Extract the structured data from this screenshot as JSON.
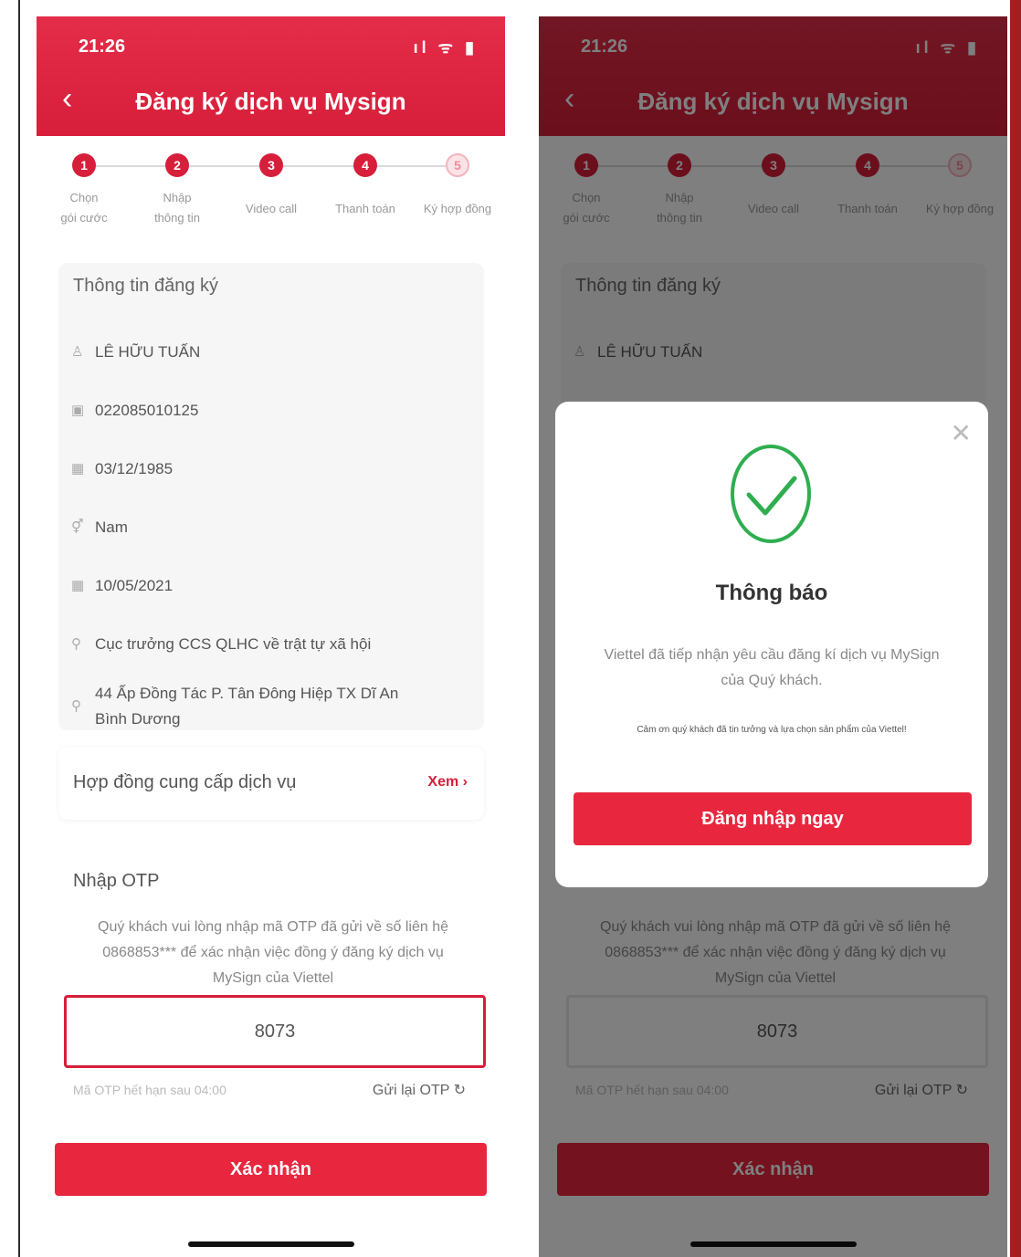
{
  "colors": {
    "brand_red": "#d71e3a",
    "button_red": "#e8273f",
    "success_green": "#2fae4f"
  },
  "status_bar": {
    "time": "21:26",
    "icons": "ıl ᯤ ▮"
  },
  "header": {
    "back_icon": "chevron-left-icon",
    "title": "Đăng ký dịch vụ Mysign"
  },
  "steps": [
    {
      "number": "1",
      "label_line1": "Chọn",
      "label_line2": "gói cước",
      "done": true
    },
    {
      "number": "2",
      "label_line1": "Nhập",
      "label_line2": "thông tin",
      "done": true
    },
    {
      "number": "3",
      "label_line1": "Video call",
      "label_line2": "",
      "done": true
    },
    {
      "number": "4",
      "label_line1": "Thanh toán",
      "label_line2": "",
      "done": true
    },
    {
      "number": "5",
      "label_line1": "Ký hợp đồng",
      "label_line2": "",
      "done": false
    }
  ],
  "registration_info": {
    "title": "Thông tin đăng ký",
    "name": "LÊ HỮU TUẤN",
    "id_number": "022085010125",
    "birth_date": "03/12/1985",
    "gender": "Nam",
    "issue_date": "10/05/2021",
    "issued_by": "Cục trưởng CCS QLHC về trật tự xã hội",
    "address_line1": "44 Ấp Đồng Tác P. Tân Đông Hiệp TX Dĩ An",
    "address_line2": "Bình Dương"
  },
  "contract": {
    "label": "Hợp đồng cung cấp dịch vụ",
    "link": "Xem"
  },
  "otp": {
    "title": "Nhập OTP",
    "description_line1": "Quý khách vui lòng nhập mã OTP đã gửi về số liên hệ",
    "description_line2": "0868853*** để xác nhận việc đồng ý đăng ký dịch vụ",
    "description_line3": "MySign của Viettel",
    "value": "8073",
    "expiry": "Mã OTP hết hạn sau 04:00",
    "resend": "Gửi lại OTP"
  },
  "confirm_button": "Xác nhận",
  "modal": {
    "title": "Thông báo",
    "message_line1": "Viettel đã tiếp nhận yêu cầu đăng kí dịch vụ MySign",
    "message_line2": "của Quý khách.",
    "note": "Cảm ơn quý khách đã tin tưởng và lựa chọn sản phẩm của Viettel!",
    "button": "Đăng nhập ngay"
  }
}
